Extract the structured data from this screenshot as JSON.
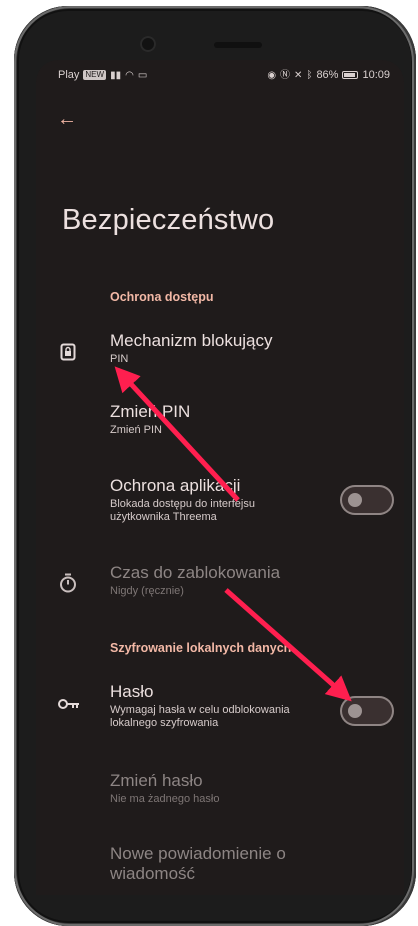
{
  "status_bar": {
    "left_label": "Play",
    "left_chip": "NEW",
    "right_battery": "86%",
    "right_time": "10:09"
  },
  "app_bar": {
    "back_icon": "arrow-left-icon"
  },
  "page_title": "Bezpieczeństwo",
  "sections": [
    {
      "header": "Ochrona dostępu",
      "items": [
        {
          "icon": "lock-screen-icon",
          "title": "Mechanizm blokujący",
          "subtitle": "PIN"
        },
        {
          "title": "Zmień PIN",
          "subtitle": "Zmień PIN"
        },
        {
          "title": "Ochrona aplikacji",
          "subtitle": "Blokada dostępu do interfejsu użytkownika Threema",
          "switch_on": false
        },
        {
          "icon": "timer-icon",
          "title": "Czas do zablokowania",
          "subtitle": "Nigdy (ręcznie)",
          "disabled": true
        }
      ]
    },
    {
      "header": "Szyfrowanie lokalnych danych",
      "items": [
        {
          "icon": "key-icon",
          "title": "Hasło",
          "subtitle": "Wymagaj hasła w celu odblokowania lokalnego szyfrowania",
          "switch_on": false
        },
        {
          "title": "Zmień hasło",
          "subtitle": "Nie ma żadnego hasło",
          "disabled": true
        },
        {
          "title": "Nowe powiadomienie o wiadomość",
          "disabled": true
        }
      ]
    }
  ],
  "colors": {
    "accent": "#f2b8a6",
    "annotation_arrow": "#ff1f4f",
    "background": "#1f1b1b"
  }
}
